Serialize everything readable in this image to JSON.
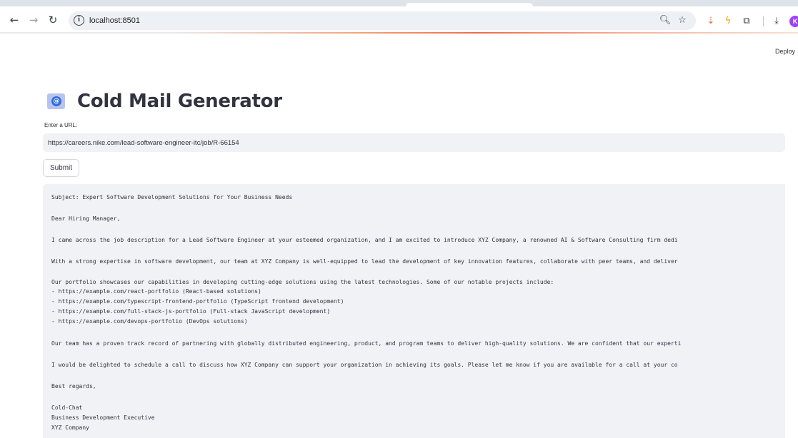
{
  "browser": {
    "url": "localhost:8501",
    "nav": {
      "back": "←",
      "forward": "→",
      "reload": "↻",
      "info": "i"
    },
    "icons": [
      "zoom-icon",
      "star-icon",
      "extension-a-icon",
      "extension-b-icon",
      "puzzle-icon",
      "download-icon"
    ],
    "avatar_letter": "K"
  },
  "app": {
    "deploy_label": "Deploy",
    "title": "Cold Mail Generator",
    "title_icon": "@",
    "url_label": "Enter a URL:",
    "url_value": "https://careers.nike.com/lead-software-engineer-itc/job/R-66154",
    "submit_label": "Submit",
    "email": {
      "subject": "Subject: Expert Software Development Solutions for Your Business Needs",
      "greeting": "Dear Hiring Manager,",
      "para1": "I came across the job description for a Lead Software Engineer at your esteemed organization, and I am excited to introduce XYZ Company, a renowned AI & Software Consulting firm dedi",
      "para2": "With a strong expertise in software development, our team at XYZ Company is well-equipped to lead the development of key innovation features, collaborate with peer teams, and deliver",
      "portfolio_intro": "Our portfolio showcases our capabilities in developing cutting-edge solutions using the latest technologies. Some of our notable projects include:",
      "portfolio": [
        "- https://example.com/react-portfolio (React-based solutions)",
        "- https://example.com/typescript-frontend-portfolio (TypeScript frontend development)",
        "- https://example.com/full-stack-js-portfolio (Full-stack JavaScript development)",
        "- https://example.com/devops-portfolio (DevOps solutions)"
      ],
      "para3": "Our team has a proven track record of partnering with globally distributed engineering, product, and program teams to deliver high-quality solutions. We are confident that our experti",
      "para4": "I would be delighted to schedule a call to discuss how XYZ Company can support your organization in achieving its goals. Please let me know if you are available for a call at your co",
      "closing": "Best regards,",
      "signature": [
        "Cold-Chat",
        "Business Development Executive",
        "XYZ Company"
      ]
    }
  },
  "colors": {
    "accent_bar": "#ef6c4a",
    "input_bg": "#f0f2f6",
    "text": "#31333f",
    "avatar": "#a142f4"
  }
}
